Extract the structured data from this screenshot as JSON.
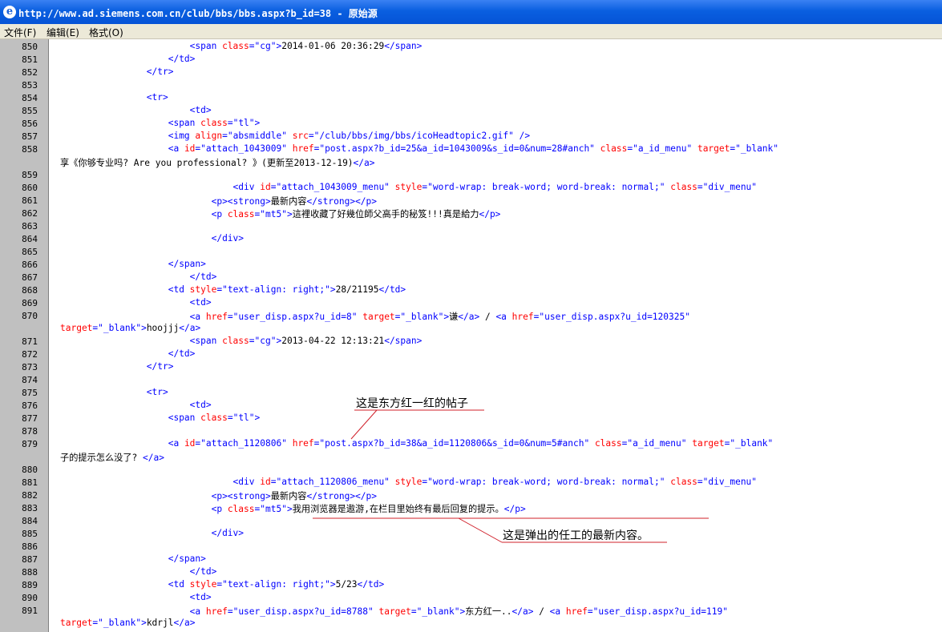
{
  "window": {
    "title": "http://www.ad.siemens.com.cn/club/bbs/bbs.aspx?b_id=38 - 原始源",
    "icon": "ie-icon"
  },
  "menu": [
    {
      "label": "文件(F)"
    },
    {
      "label": "编辑(E)"
    },
    {
      "label": "格式(O)"
    }
  ],
  "gutter_numbers": [
    "850",
    "851",
    "852",
    "853",
    "854",
    "855",
    "856",
    "857",
    "858",
    "",
    "859",
    "860",
    "861",
    "862",
    "863",
    "864",
    "865",
    "866",
    "867",
    "868",
    "869",
    "870",
    "",
    "871",
    "872",
    "873",
    "874",
    "875",
    "876",
    "877",
    "878",
    "879",
    "",
    "880",
    "881",
    "882",
    "883",
    "884",
    "885",
    "886",
    "887",
    "888",
    "889",
    "890",
    "891",
    ""
  ],
  "code_lines": [
    {
      "i": "                        ",
      "t": [
        [
          "tg",
          "<span "
        ],
        [
          "at",
          "class"
        ],
        [
          "tg",
          "="
        ],
        [
          "av",
          "\"cg\""
        ],
        [
          "tg",
          ">"
        ],
        [
          "tx",
          "2014-01-06 20:36:29"
        ],
        [
          "tg",
          "</span>"
        ]
      ]
    },
    {
      "i": "                    ",
      "t": [
        [
          "tg",
          "</td>"
        ]
      ]
    },
    {
      "i": "                ",
      "t": [
        [
          "tg",
          "</tr>"
        ]
      ]
    },
    {
      "i": "",
      "t": []
    },
    {
      "i": "                ",
      "t": [
        [
          "tg",
          "<tr>"
        ]
      ]
    },
    {
      "i": "                        ",
      "t": [
        [
          "tg",
          "<td>"
        ]
      ]
    },
    {
      "i": "                    ",
      "t": [
        [
          "tg",
          "<span "
        ],
        [
          "at",
          "class"
        ],
        [
          "tg",
          "="
        ],
        [
          "av",
          "\"tl\""
        ],
        [
          "tg",
          ">"
        ]
      ]
    },
    {
      "i": "                    ",
      "t": [
        [
          "tg",
          "<img "
        ],
        [
          "at",
          "align"
        ],
        [
          "tg",
          "="
        ],
        [
          "av",
          "\"absmiddle\""
        ],
        [
          "tg",
          " "
        ],
        [
          "at",
          "src"
        ],
        [
          "tg",
          "="
        ],
        [
          "av",
          "\"/club/bbs/img/bbs/icoHeadtopic2.gif\""
        ],
        [
          "tg",
          " />"
        ]
      ]
    },
    {
      "i": "                    ",
      "t": [
        [
          "tg",
          "<a "
        ],
        [
          "at",
          "id"
        ],
        [
          "tg",
          "="
        ],
        [
          "av",
          "\"attach_1043009\""
        ],
        [
          "tg",
          " "
        ],
        [
          "at",
          "href"
        ],
        [
          "tg",
          "="
        ],
        [
          "av",
          "\"post.aspx?b_id=25&a_id=1043009&s_id=0&num=28#anch\""
        ],
        [
          "tg",
          " "
        ],
        [
          "at",
          "class"
        ],
        [
          "tg",
          "="
        ],
        [
          "av",
          "\"a_id_menu\""
        ],
        [
          "tg",
          " "
        ],
        [
          "at",
          "target"
        ],
        [
          "tg",
          "="
        ],
        [
          "av",
          "\"_blank\""
        ]
      ]
    },
    {
      "i": "",
      "t": [
        [
          "tx",
          "享《你够专业吗? Are you professional? 》(更新至2013-12-19)"
        ],
        [
          "tg",
          "</a>"
        ]
      ]
    },
    {
      "i": "",
      "t": []
    },
    {
      "i": "                                ",
      "t": [
        [
          "tg",
          "<div "
        ],
        [
          "at",
          "id"
        ],
        [
          "tg",
          "="
        ],
        [
          "av",
          "\"attach_1043009_menu\""
        ],
        [
          "tg",
          " "
        ],
        [
          "at",
          "style"
        ],
        [
          "tg",
          "="
        ],
        [
          "av",
          "\"word-wrap: break-word; word-break: normal;\""
        ],
        [
          "tg",
          " "
        ],
        [
          "at",
          "class"
        ],
        [
          "tg",
          "="
        ],
        [
          "av",
          "\"div_menu\""
        ]
      ]
    },
    {
      "i": "                            ",
      "t": [
        [
          "tg",
          "<p><strong>"
        ],
        [
          "tx",
          "最新内容"
        ],
        [
          "tg",
          "</strong></p>"
        ]
      ]
    },
    {
      "i": "                            ",
      "t": [
        [
          "tg",
          "<p "
        ],
        [
          "at",
          "class"
        ],
        [
          "tg",
          "="
        ],
        [
          "av",
          "\"mt5\""
        ],
        [
          "tg",
          ">"
        ],
        [
          "tx",
          "這裡收藏了好幾位師父高手的秘笈!!!真是給力"
        ],
        [
          "tg",
          "</p>"
        ]
      ]
    },
    {
      "i": "",
      "t": []
    },
    {
      "i": "                            ",
      "t": [
        [
          "tg",
          "</div>"
        ]
      ]
    },
    {
      "i": "",
      "t": []
    },
    {
      "i": "                    ",
      "t": [
        [
          "tg",
          "</span>"
        ]
      ]
    },
    {
      "i": "                        ",
      "t": [
        [
          "tg",
          "</td>"
        ]
      ]
    },
    {
      "i": "                    ",
      "t": [
        [
          "tg",
          "<td "
        ],
        [
          "at",
          "style"
        ],
        [
          "tg",
          "="
        ],
        [
          "av",
          "\"text-align: right;\""
        ],
        [
          "tg",
          ">"
        ],
        [
          "tx",
          "28/21195"
        ],
        [
          "tg",
          "</td>"
        ]
      ]
    },
    {
      "i": "                        ",
      "t": [
        [
          "tg",
          "<td>"
        ]
      ]
    },
    {
      "i": "                        ",
      "t": [
        [
          "tg",
          "<a "
        ],
        [
          "at",
          "href"
        ],
        [
          "tg",
          "="
        ],
        [
          "av",
          "\"user_disp.aspx?u_id=8\""
        ],
        [
          "tg",
          " "
        ],
        [
          "at",
          "target"
        ],
        [
          "tg",
          "="
        ],
        [
          "av",
          "\"_blank\""
        ],
        [
          "tg",
          ">"
        ],
        [
          "tx",
          "谦"
        ],
        [
          "tg",
          "</a>"
        ],
        [
          "tx",
          " / "
        ],
        [
          "tg",
          "<a "
        ],
        [
          "at",
          "href"
        ],
        [
          "tg",
          "="
        ],
        [
          "av",
          "\"user_disp.aspx?u_id=120325\""
        ]
      ]
    },
    {
      "i": "",
      "t": [
        [
          "at",
          "target"
        ],
        [
          "tg",
          "="
        ],
        [
          "av",
          "\"_blank\""
        ],
        [
          "tg",
          ">"
        ],
        [
          "tx",
          "hoojjj"
        ],
        [
          "tg",
          "</a>"
        ]
      ]
    },
    {
      "i": "                        ",
      "t": [
        [
          "tg",
          "<span "
        ],
        [
          "at",
          "class"
        ],
        [
          "tg",
          "="
        ],
        [
          "av",
          "\"cg\""
        ],
        [
          "tg",
          ">"
        ],
        [
          "tx",
          "2013-04-22 12:13:21"
        ],
        [
          "tg",
          "</span>"
        ]
      ]
    },
    {
      "i": "                    ",
      "t": [
        [
          "tg",
          "</td>"
        ]
      ]
    },
    {
      "i": "                ",
      "t": [
        [
          "tg",
          "</tr>"
        ]
      ]
    },
    {
      "i": "",
      "t": []
    },
    {
      "i": "                ",
      "t": [
        [
          "tg",
          "<tr>"
        ]
      ]
    },
    {
      "i": "                        ",
      "t": [
        [
          "tg",
          "<td>"
        ]
      ]
    },
    {
      "i": "                    ",
      "t": [
        [
          "tg",
          "<span "
        ],
        [
          "at",
          "class"
        ],
        [
          "tg",
          "="
        ],
        [
          "av",
          "\"tl\""
        ],
        [
          "tg",
          ">"
        ]
      ]
    },
    {
      "i": "",
      "t": []
    },
    {
      "i": "                    ",
      "t": [
        [
          "tg",
          "<a "
        ],
        [
          "at",
          "id"
        ],
        [
          "tg",
          "="
        ],
        [
          "av",
          "\"attach_1120806\""
        ],
        [
          "tg",
          " "
        ],
        [
          "at",
          "href"
        ],
        [
          "tg",
          "="
        ],
        [
          "av",
          "\"post.aspx?b_id=38&a_id=1120806&s_id=0&num=5#anch\""
        ],
        [
          "tg",
          " "
        ],
        [
          "at",
          "class"
        ],
        [
          "tg",
          "="
        ],
        [
          "av",
          "\"a_id_menu\""
        ],
        [
          "tg",
          " "
        ],
        [
          "at",
          "target"
        ],
        [
          "tg",
          "="
        ],
        [
          "av",
          "\"_blank\""
        ]
      ]
    },
    {
      "i": "",
      "t": [
        [
          "tx",
          "子的提示怎么没了? "
        ],
        [
          "tg",
          "</a>"
        ]
      ]
    },
    {
      "i": "",
      "t": []
    },
    {
      "i": "                                ",
      "t": [
        [
          "tg",
          "<div "
        ],
        [
          "at",
          "id"
        ],
        [
          "tg",
          "="
        ],
        [
          "av",
          "\"attach_1120806_menu\""
        ],
        [
          "tg",
          " "
        ],
        [
          "at",
          "style"
        ],
        [
          "tg",
          "="
        ],
        [
          "av",
          "\"word-wrap: break-word; word-break: normal;\""
        ],
        [
          "tg",
          " "
        ],
        [
          "at",
          "class"
        ],
        [
          "tg",
          "="
        ],
        [
          "av",
          "\"div_menu\""
        ]
      ]
    },
    {
      "i": "                            ",
      "t": [
        [
          "tg",
          "<p><strong>"
        ],
        [
          "tx",
          "最新内容"
        ],
        [
          "tg",
          "</strong></p>"
        ]
      ]
    },
    {
      "i": "                            ",
      "t": [
        [
          "tg",
          "<p "
        ],
        [
          "at",
          "class"
        ],
        [
          "tg",
          "="
        ],
        [
          "av",
          "\"mt5\""
        ],
        [
          "tg",
          ">"
        ],
        [
          "tx",
          "我用浏览器是遨游,在栏目里始终有最后回复的提示。"
        ],
        [
          "tg",
          "</p>"
        ]
      ]
    },
    {
      "i": "",
      "t": []
    },
    {
      "i": "                            ",
      "t": [
        [
          "tg",
          "</div>"
        ]
      ]
    },
    {
      "i": "",
      "t": []
    },
    {
      "i": "                    ",
      "t": [
        [
          "tg",
          "</span>"
        ]
      ]
    },
    {
      "i": "                        ",
      "t": [
        [
          "tg",
          "</td>"
        ]
      ]
    },
    {
      "i": "                    ",
      "t": [
        [
          "tg",
          "<td "
        ],
        [
          "at",
          "style"
        ],
        [
          "tg",
          "="
        ],
        [
          "av",
          "\"text-align: right;\""
        ],
        [
          "tg",
          ">"
        ],
        [
          "tx",
          "5/23"
        ],
        [
          "tg",
          "</td>"
        ]
      ]
    },
    {
      "i": "                        ",
      "t": [
        [
          "tg",
          "<td>"
        ]
      ]
    },
    {
      "i": "                        ",
      "t": [
        [
          "tg",
          "<a "
        ],
        [
          "at",
          "href"
        ],
        [
          "tg",
          "="
        ],
        [
          "av",
          "\"user_disp.aspx?u_id=8788\""
        ],
        [
          "tg",
          " "
        ],
        [
          "at",
          "target"
        ],
        [
          "tg",
          "="
        ],
        [
          "av",
          "\"_blank\""
        ],
        [
          "tg",
          ">"
        ],
        [
          "tx",
          "东方红一.."
        ],
        [
          "tg",
          "</a>"
        ],
        [
          "tx",
          " / "
        ],
        [
          "tg",
          "<a "
        ],
        [
          "at",
          "href"
        ],
        [
          "tg",
          "="
        ],
        [
          "av",
          "\"user_disp.aspx?u_id=119\""
        ]
      ]
    },
    {
      "i": "",
      "t": [
        [
          "at",
          "target"
        ],
        [
          "tg",
          "="
        ],
        [
          "av",
          "\"_blank\""
        ],
        [
          "tg",
          ">"
        ],
        [
          "tx",
          "kdrjl"
        ],
        [
          "tg",
          "</a>"
        ]
      ]
    }
  ],
  "annotations": {
    "post_note": "这是东方红一红的帖子",
    "content_note": "这是弹出的任工的最新内容。"
  },
  "colors": {
    "tag": "#0000ff",
    "attr": "#ff0000",
    "annotation_line": "#d0202a",
    "titlebar": "#0a5fe0",
    "gutter": "#c0c0c0"
  }
}
